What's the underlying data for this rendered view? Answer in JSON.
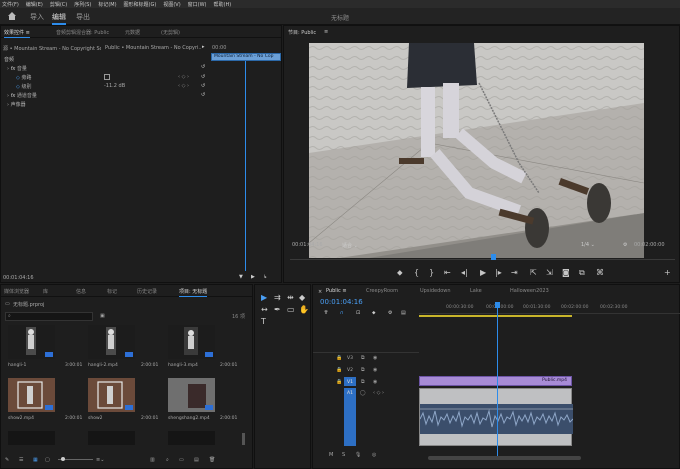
{
  "menu": [
    "文件(F)",
    "编辑(E)",
    "剪辑(C)",
    "序列(S)",
    "标记(M)",
    "图形和标题(G)",
    "视图(V)",
    "窗口(W)",
    "帮助(H)"
  ],
  "workspace": {
    "tabs": [
      "导入",
      "编辑",
      "导出"
    ],
    "title": "无标题"
  },
  "effect_controls": {
    "tabs": [
      "效果控件 ≡",
      "音频剪辑混合器: Public",
      "元数据",
      "(无剪辑)"
    ],
    "source_clip": "源 • Mountain Stream - No Copyright So...",
    "target_clip": "Public • Mountain Stream - No Copyri...",
    "mini_tc": "00:00",
    "mini_clip": "Mountain Stream - No Cop",
    "section_audio": "音频",
    "fx_volume": "音量",
    "bypass": "旁路",
    "level_label": "级别",
    "level_value": "-11.2 dB",
    "fx_channel_volume": "通道音量",
    "fx_panner": "声像器",
    "timecode": "00:01:04:16"
  },
  "program": {
    "title": "节目: Public",
    "timecode": "00:01:04:16",
    "fit": "适合",
    "quality": "1/4",
    "duration": "00:02:00:00"
  },
  "project": {
    "tabs": [
      "项目: 无标题",
      "媒体浏览器",
      "库",
      "信息",
      "标记",
      "历史记录"
    ],
    "filename": "无标题.prproj",
    "search_placeholder": "",
    "count": "16 项",
    "items": [
      {
        "name": "hangli-1",
        "duration": "3:00:01"
      },
      {
        "name": "hangli-2.mp4",
        "duration": "2:00:01"
      },
      {
        "name": "hangli-3.mp4",
        "duration": "2:00:01"
      },
      {
        "name": "show2.mp4",
        "duration": "2:00:01"
      },
      {
        "name": "show2",
        "duration": "2:00:01"
      },
      {
        "name": "shengshang2.mp4",
        "duration": "2:00:01"
      }
    ]
  },
  "timeline": {
    "sequence_tabs": [
      "Public ≡",
      "CreepyRoom",
      "Upsidedown",
      "Lake",
      "Halloween2023"
    ],
    "timecode": "00:01:04:16",
    "ruler": [
      "00:00:30:00",
      "00:01:00:00",
      "00:01:30:00",
      "00:02:00:00",
      "00:02:30:00"
    ],
    "tracks": [
      "V3",
      "V2",
      "V1",
      "A1"
    ],
    "clip_v1": "Public.mp4"
  },
  "colors": {
    "accent": "#2d8ceb",
    "video_clip": "#a78bd6",
    "audio_clip": "#bfc0c2"
  }
}
